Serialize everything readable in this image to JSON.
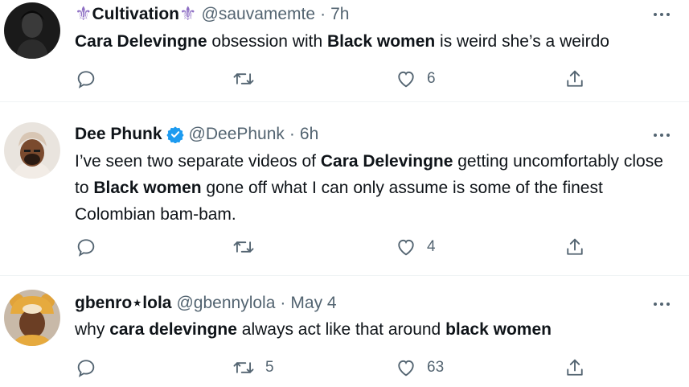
{
  "tweets": [
    {
      "display_name": "Cultivation",
      "name_decoration": "⚜",
      "handle": "@sauvamemte",
      "time": "7h",
      "verified": false,
      "body_segments": [
        {
          "text": "Cara Delevingne",
          "bold": true
        },
        {
          "text": " obsession with ",
          "bold": false
        },
        {
          "text": "Black women",
          "bold": true
        },
        {
          "text": " is weird she’s a weirdo",
          "bold": false
        }
      ],
      "retweets": "",
      "likes": "6"
    },
    {
      "display_name": "Dee Phunk",
      "handle": "@DeePhunk",
      "time": "6h",
      "verified": true,
      "body_segments": [
        {
          "text": "I’ve seen two separate videos of ",
          "bold": false
        },
        {
          "text": "Cara Delevingne",
          "bold": true
        },
        {
          "text": " getting uncomfortably close to ",
          "bold": false
        },
        {
          "text": "Black women",
          "bold": true
        },
        {
          "text": " gone off what I can only assume is some of the finest Colombian bam-bam.",
          "bold": false
        }
      ],
      "retweets": "",
      "likes": "4"
    },
    {
      "display_name": "gbenro⋆lola",
      "handle": "@gbennylola",
      "time": "May 4",
      "verified": false,
      "body_segments": [
        {
          "text": "why ",
          "bold": false
        },
        {
          "text": "cara delevingne",
          "bold": true
        },
        {
          "text": " always act like that around ",
          "bold": false
        },
        {
          "text": "black women",
          "bold": true
        }
      ],
      "retweets": "5",
      "likes": "63"
    }
  ],
  "separator": "·",
  "colors": {
    "text": "#0f1419",
    "secondary": "#536471",
    "divider": "#eff3f4",
    "verified": "#1d9bf0",
    "decoration": "#8e6fc4"
  },
  "icons": {
    "reply": "reply-icon",
    "retweet": "retweet-icon",
    "like": "heart-icon",
    "share": "share-icon",
    "more": "more-icon",
    "verified": "verified-badge-icon"
  }
}
